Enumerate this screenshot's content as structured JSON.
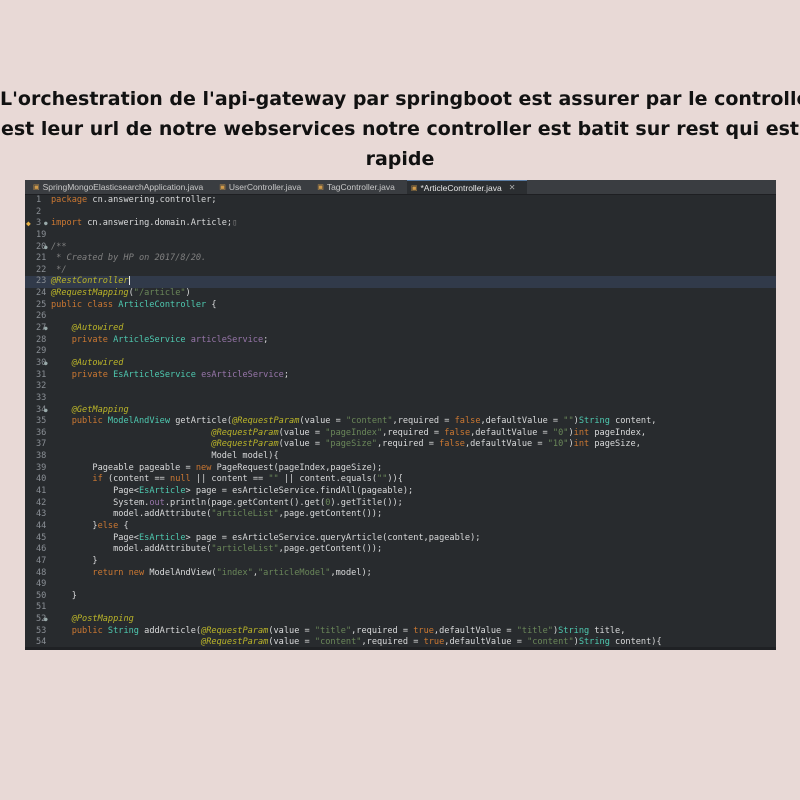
{
  "caption": {
    "lines": [
      "L'orchestration de l'api-gateway par springboot est assurer par le controller",
      "est leur url de notre webservices notre controller est batit sur rest qui est",
      "rapide"
    ]
  },
  "tabs": [
    {
      "label": "SpringMongoElasticsearchApplication.java",
      "active": false
    },
    {
      "label": "UserController.java",
      "active": false
    },
    {
      "label": "TagController.java",
      "active": false
    },
    {
      "label": "*ArticleController.java",
      "active": true,
      "close": "✕"
    }
  ],
  "colors": {
    "keyword": "#cc7832",
    "string": "#6a8759",
    "annotation": "#bbb529",
    "comment": "#808080",
    "type": "#4ec9b0",
    "field": "#9876aa",
    "text": "#d9dadb"
  },
  "editor": {
    "lines": [
      {
        "n": "1",
        "segs": [
          [
            "k",
            "package "
          ],
          [
            "t",
            "cn.answering.controller;"
          ]
        ]
      },
      {
        "n": "2",
        "segs": []
      },
      {
        "n": "3",
        "marker": "warning",
        "fold": true,
        "segs": [
          [
            "k",
            "import "
          ],
          [
            "t",
            "cn.answering.domain.Article;"
          ],
          [
            "c",
            "▯"
          ]
        ]
      },
      {
        "n": "19",
        "segs": []
      },
      {
        "n": "20",
        "fold": true,
        "segs": [
          [
            "c",
            "/**"
          ]
        ]
      },
      {
        "n": "21",
        "segs": [
          [
            "c",
            " * Created by HP on 2017/8/20."
          ]
        ]
      },
      {
        "n": "22",
        "segs": [
          [
            "c",
            " */"
          ]
        ]
      },
      {
        "n": "23",
        "hl": true,
        "caret": true,
        "segs": [
          [
            "a",
            "@RestController"
          ]
        ]
      },
      {
        "n": "24",
        "segs": [
          [
            "a",
            "@RequestMapping"
          ],
          [
            "t",
            "("
          ],
          [
            "s",
            "\"/article\""
          ],
          [
            "t",
            ")"
          ]
        ]
      },
      {
        "n": "25",
        "segs": [
          [
            "k",
            "public class "
          ],
          [
            "y",
            "ArticleController "
          ],
          [
            "t",
            "{"
          ]
        ]
      },
      {
        "n": "26",
        "segs": []
      },
      {
        "n": "27",
        "fold": true,
        "segs": [
          [
            "t",
            "    "
          ],
          [
            "a",
            "@Autowired"
          ]
        ]
      },
      {
        "n": "28",
        "segs": [
          [
            "t",
            "    "
          ],
          [
            "k",
            "private "
          ],
          [
            "y",
            "ArticleService "
          ],
          [
            "f",
            "articleService"
          ],
          [
            "t",
            ";"
          ]
        ]
      },
      {
        "n": "29",
        "segs": []
      },
      {
        "n": "30",
        "fold": true,
        "segs": [
          [
            "t",
            "    "
          ],
          [
            "a",
            "@Autowired"
          ]
        ]
      },
      {
        "n": "31",
        "segs": [
          [
            "t",
            "    "
          ],
          [
            "k",
            "private "
          ],
          [
            "y",
            "EsArticleService "
          ],
          [
            "f",
            "esArticleService"
          ],
          [
            "t",
            ";"
          ]
        ]
      },
      {
        "n": "32",
        "segs": []
      },
      {
        "n": "33",
        "segs": []
      },
      {
        "n": "34",
        "fold": true,
        "segs": [
          [
            "t",
            "    "
          ],
          [
            "a",
            "@GetMapping"
          ]
        ]
      },
      {
        "n": "35",
        "segs": [
          [
            "t",
            "    "
          ],
          [
            "k",
            "public "
          ],
          [
            "y",
            "ModelAndView "
          ],
          [
            "t",
            "getArticle("
          ],
          [
            "a",
            "@RequestParam"
          ],
          [
            "t",
            "(value = "
          ],
          [
            "s",
            "\"content\""
          ],
          [
            "t",
            ",required = "
          ],
          [
            "k",
            "false"
          ],
          [
            "t",
            ",defaultValue = "
          ],
          [
            "s",
            "\"\""
          ],
          [
            "t",
            ")"
          ],
          [
            "y",
            "String "
          ],
          [
            "t",
            "content,"
          ]
        ]
      },
      {
        "n": "36",
        "segs": [
          [
            "t",
            "                               "
          ],
          [
            "a",
            "@RequestParam"
          ],
          [
            "t",
            "(value = "
          ],
          [
            "s",
            "\"pageIndex\""
          ],
          [
            "t",
            ",required = "
          ],
          [
            "k",
            "false"
          ],
          [
            "t",
            ",defaultValue = "
          ],
          [
            "s",
            "\"0\""
          ],
          [
            "t",
            ")"
          ],
          [
            "k",
            "int "
          ],
          [
            "t",
            "pageIndex,"
          ]
        ]
      },
      {
        "n": "37",
        "segs": [
          [
            "t",
            "                               "
          ],
          [
            "a",
            "@RequestParam"
          ],
          [
            "t",
            "(value = "
          ],
          [
            "s",
            "\"pageSize\""
          ],
          [
            "t",
            ",required = "
          ],
          [
            "k",
            "false"
          ],
          [
            "t",
            ",defaultValue = "
          ],
          [
            "s",
            "\"10\""
          ],
          [
            "t",
            ")"
          ],
          [
            "k",
            "int "
          ],
          [
            "t",
            "pageSize,"
          ]
        ]
      },
      {
        "n": "38",
        "segs": [
          [
            "t",
            "                               Model model){"
          ]
        ]
      },
      {
        "n": "39",
        "segs": [
          [
            "t",
            "        Pageable pageable = "
          ],
          [
            "k",
            "new "
          ],
          [
            "t",
            "PageRequest(pageIndex,pageSize);"
          ]
        ]
      },
      {
        "n": "40",
        "segs": [
          [
            "t",
            "        "
          ],
          [
            "k",
            "if "
          ],
          [
            "t",
            "(content == "
          ],
          [
            "k",
            "null "
          ],
          [
            "t",
            "|| content == "
          ],
          [
            "s",
            "\"\" "
          ],
          [
            "t",
            "|| content.equals("
          ],
          [
            "s",
            "\"\""
          ],
          [
            "t",
            ")){"
          ]
        ]
      },
      {
        "n": "41",
        "segs": [
          [
            "t",
            "            Page<"
          ],
          [
            "y",
            "EsArticle"
          ],
          [
            "t",
            "> page = esArticleService.findAll(pageable);"
          ]
        ]
      },
      {
        "n": "42",
        "segs": [
          [
            "t",
            "            System."
          ],
          [
            "f",
            "out"
          ],
          [
            "t",
            ".println(page.getContent().get("
          ],
          [
            "s",
            "0"
          ],
          [
            "t",
            ").getTitle());"
          ]
        ]
      },
      {
        "n": "43",
        "segs": [
          [
            "t",
            "            model.addAttribute("
          ],
          [
            "s",
            "\"articleList\""
          ],
          [
            "t",
            ",page.getContent());"
          ]
        ]
      },
      {
        "n": "44",
        "segs": [
          [
            "t",
            "        }"
          ],
          [
            "k",
            "else "
          ],
          [
            "t",
            "{"
          ]
        ]
      },
      {
        "n": "45",
        "segs": [
          [
            "t",
            "            Page<"
          ],
          [
            "y",
            "EsArticle"
          ],
          [
            "t",
            "> page = esArticleService.queryArticle(content,pageable);"
          ]
        ]
      },
      {
        "n": "46",
        "segs": [
          [
            "t",
            "            model.addAttribute("
          ],
          [
            "s",
            "\"articleList\""
          ],
          [
            "t",
            ",page.getContent());"
          ]
        ]
      },
      {
        "n": "47",
        "segs": [
          [
            "t",
            "        }"
          ]
        ]
      },
      {
        "n": "48",
        "segs": [
          [
            "t",
            "        "
          ],
          [
            "k",
            "return new "
          ],
          [
            "t",
            "ModelAndView("
          ],
          [
            "s",
            "\"index\""
          ],
          [
            "t",
            ","
          ],
          [
            "s",
            "\"articleModel\""
          ],
          [
            "t",
            ",model);"
          ]
        ]
      },
      {
        "n": "49",
        "segs": []
      },
      {
        "n": "50",
        "segs": [
          [
            "t",
            "    }"
          ]
        ]
      },
      {
        "n": "51",
        "segs": []
      },
      {
        "n": "52",
        "fold": true,
        "segs": [
          [
            "t",
            "    "
          ],
          [
            "a",
            "@PostMapping"
          ]
        ]
      },
      {
        "n": "53",
        "segs": [
          [
            "t",
            "    "
          ],
          [
            "k",
            "public "
          ],
          [
            "y",
            "String "
          ],
          [
            "t",
            "addArticle("
          ],
          [
            "a",
            "@RequestParam"
          ],
          [
            "t",
            "(value = "
          ],
          [
            "s",
            "\"title\""
          ],
          [
            "t",
            ",required = "
          ],
          [
            "k",
            "true"
          ],
          [
            "t",
            ",defaultValue = "
          ],
          [
            "s",
            "\"title\""
          ],
          [
            "t",
            ")"
          ],
          [
            "y",
            "String "
          ],
          [
            "t",
            "title,"
          ]
        ]
      },
      {
        "n": "54",
        "segs": [
          [
            "t",
            "                             "
          ],
          [
            "a",
            "@RequestParam"
          ],
          [
            "t",
            "(value = "
          ],
          [
            "s",
            "\"content\""
          ],
          [
            "t",
            ",required = "
          ],
          [
            "k",
            "true"
          ],
          [
            "t",
            ",defaultValue = "
          ],
          [
            "s",
            "\"content\""
          ],
          [
            "t",
            ")"
          ],
          [
            "y",
            "String "
          ],
          [
            "t",
            "content){"
          ]
        ]
      },
      {
        "n": "",
        "segs": [
          [
            "t",
            "{"
          ]
        ]
      }
    ]
  }
}
